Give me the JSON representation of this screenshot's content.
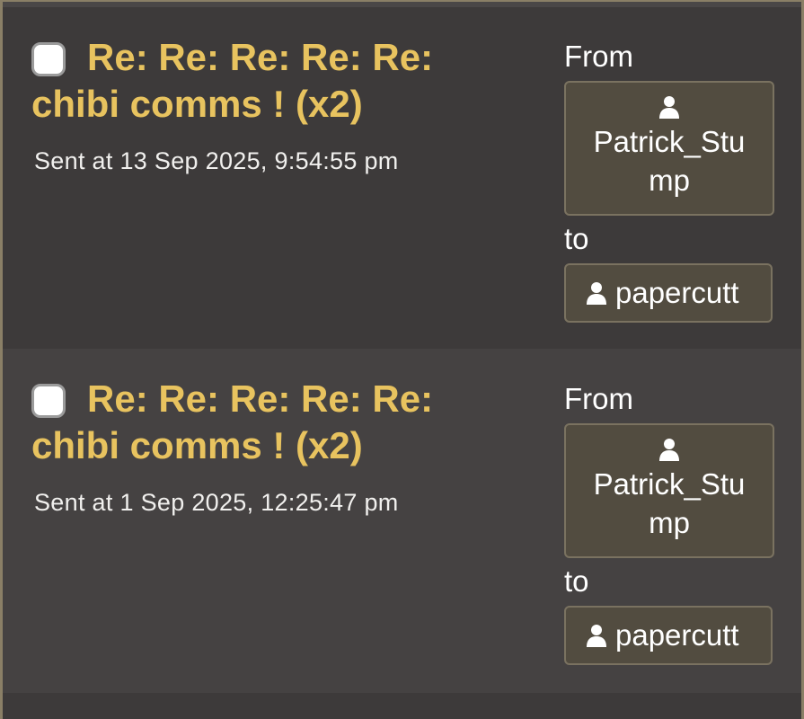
{
  "messages": [
    {
      "subject": "Re: Re: Re: Re: Re: chibi comms ! (x2)",
      "sent": "Sent at 13 Sep 2025, 9:54:55 pm",
      "from_label": "From",
      "from_user_line1": "Patrick_Stu",
      "from_user_line2": "mp",
      "to_label": "to",
      "to_user": "papercutt",
      "icon": "user-icon"
    },
    {
      "subject": "Re: Re: Re: Re: Re: chibi comms ! (x2)",
      "sent": "Sent at 1 Sep 2025, 12:25:47 pm",
      "from_label": "From",
      "from_user_line1": "Patrick_Stu",
      "from_user_line2": "mp",
      "to_label": "to",
      "to_user": "papercutt",
      "icon": "user-icon"
    }
  ],
  "colors": {
    "subject": "#e8c35f",
    "background_odd": "#3d3a3a",
    "background_even": "#454242",
    "button_bg": "#524c40",
    "border": "#8a7f66"
  }
}
